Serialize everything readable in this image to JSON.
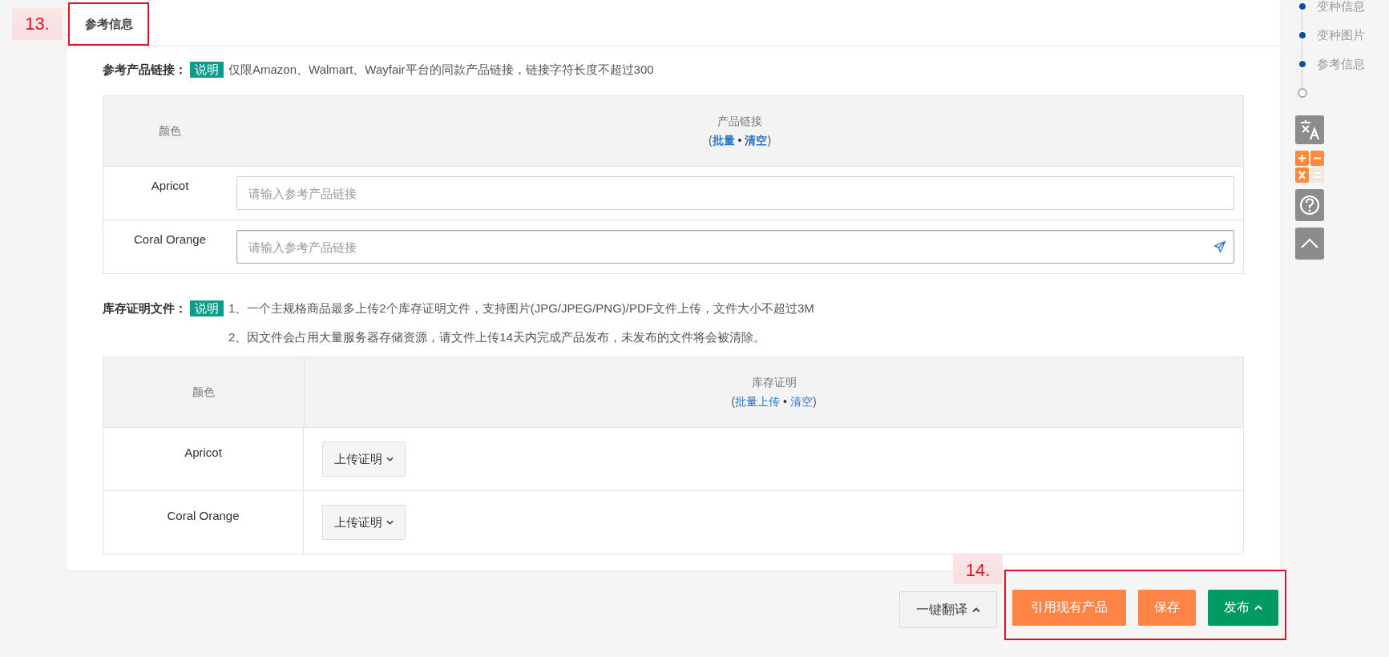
{
  "annotations": [
    {
      "label": "13."
    },
    {
      "label": "14."
    }
  ],
  "section_tab": {
    "label": "参考信息"
  },
  "reference_links": {
    "label": "参考产品链接：",
    "badge": "说明",
    "notes": [
      "仅限Amazon、Walmart、Wayfair平台的同款产品链接，链接字符长度不超过300"
    ],
    "columns": [
      {
        "title": "颜色"
      },
      {
        "title": "产品链接",
        "actions": [
          "批量",
          "清空"
        ]
      }
    ],
    "separator": "•",
    "brackets": [
      "(",
      ")"
    ],
    "rows": [
      {
        "variant": "Apricot",
        "placeholder": "请输入参考产品链接",
        "focused": false
      },
      {
        "variant": "Coral Orange",
        "placeholder": "请输入参考产品链接",
        "focused": true
      }
    ]
  },
  "inventory_proof": {
    "label": "库存证明文件：",
    "badge": "说明",
    "notes": [
      "1、一个主规格商品最多上传2个库存证明文件，支持图片(JPG/JPEG/PNG)/PDF文件上传，文件大小不超过3M",
      "2、因文件会占用大量服务器存储资源，请文件上传14天内完成产品发布，未发布的文件将会被清除。"
    ],
    "columns": [
      {
        "title": "颜色"
      },
      {
        "title": "库存证明",
        "actions": [
          "批量上传",
          "清空"
        ]
      }
    ],
    "separator": "•",
    "brackets": [
      "(",
      ")"
    ],
    "rows": [
      {
        "variant": "Apricot",
        "button": "上传证明"
      },
      {
        "variant": "Coral Orange",
        "button": "上传证明"
      }
    ]
  },
  "footer_buttons": [
    {
      "label": "一键翻译",
      "kind": "default",
      "caret": true
    },
    {
      "label": "引用现有产品",
      "kind": "orange",
      "caret": false
    },
    {
      "label": "保存",
      "kind": "orange",
      "caret": false
    },
    {
      "label": "发布",
      "kind": "green",
      "caret": true
    }
  ],
  "side_nav": [
    {
      "label": "变种信息",
      "done": true
    },
    {
      "label": "变种图片",
      "done": true
    },
    {
      "label": "参考信息",
      "done": true
    },
    {
      "done": false
    }
  ]
}
